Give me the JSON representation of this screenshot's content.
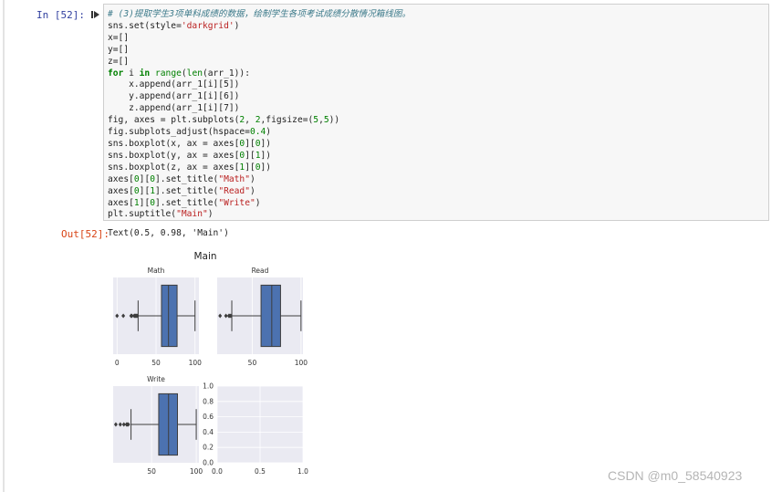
{
  "cell": {
    "in_prompt": "In  [52]:",
    "out_prompt": "Out[52]:",
    "output_text": "Text(0.5, 0.98, 'Main')",
    "code": {
      "line1": "# (3)提取学生3项单科成绩的数据，绘制学生各项考试成绩分散情况箱线图。",
      "l2a": "sns.set(style=",
      "l2b": "'darkgrid'",
      "l2c": ")",
      "l3": "x=[]",
      "l4": "y=[]",
      "l5": "z=[]",
      "l6a": "for",
      "l6b": " i ",
      "l6c": "in",
      "l6d": " ",
      "l6e": "range",
      "l6f": "(",
      "l6g": "len",
      "l6h": "(arr_1)):",
      "l7": "    x.append(arr_1[i][5])",
      "l8": "    y.append(arr_1[i][6])",
      "l9": "    z.append(arr_1[i][7])",
      "l10a": "fig, axes = plt.subplots(",
      "l10b": "2",
      "l10c": ", ",
      "l10d": "2",
      "l10e": ",figsize=(",
      "l10f": "5",
      "l10g": ",",
      "l10h": "5",
      "l10i": "))",
      "l11a": "fig.subplots_adjust(hspace=",
      "l11b": "0.4",
      "l11c": ")",
      "l12a": "sns.boxplot(x, ax = axes[",
      "l12b": "0",
      "l12c": "][",
      "l12d": "0",
      "l12e": "])",
      "l13a": "sns.boxplot(y, ax = axes[",
      "l13b": "0",
      "l13c": "][",
      "l13d": "1",
      "l13e": "])",
      "l14a": "sns.boxplot(z, ax = axes[",
      "l14b": "1",
      "l14c": "][",
      "l14d": "0",
      "l14e": "])",
      "l15a": "axes[",
      "l15b": "0",
      "l15c": "][",
      "l15d": "0",
      "l15e": "].set_title(",
      "l15f": "\"Math\"",
      "l15g": ")",
      "l16a": "axes[",
      "l16b": "0",
      "l16c": "][",
      "l16d": "1",
      "l16e": "].set_title(",
      "l16f": "\"Read\"",
      "l16g": ")",
      "l17a": "axes[",
      "l17b": "1",
      "l17c": "][",
      "l17d": "0",
      "l17e": "].set_title(",
      "l17f": "\"Write\"",
      "l17g": ")",
      "l18a": "plt.suptitle(",
      "l18b": "\"Main\"",
      "l18c": ")"
    }
  },
  "colors": {
    "box_fill": "#4c72b0",
    "axes_bg": "#eaeaf2",
    "prompt_in": "#303f9f",
    "prompt_out": "#d84315"
  },
  "icons": {
    "run": "run-arrow-icon"
  },
  "chart_data": [
    {
      "type": "boxplot",
      "title": "Main",
      "subplot": "suptitle"
    },
    {
      "type": "boxplot",
      "title": "Math",
      "xlim": [
        -5,
        105
      ],
      "xticks": [
        0,
        50,
        100
      ],
      "min": 27,
      "q1": 57,
      "median": 66,
      "q3": 77,
      "max": 100,
      "outliers": [
        0,
        8,
        18,
        19,
        22,
        23,
        24,
        25,
        26
      ]
    },
    {
      "type": "boxplot",
      "title": "Read",
      "xlim": [
        14,
        102
      ],
      "xticks": [
        50,
        100
      ],
      "min": 29,
      "q1": 59,
      "median": 70,
      "q3": 79,
      "max": 100,
      "outliers": [
        17,
        23,
        26,
        27,
        28
      ]
    },
    {
      "type": "boxplot",
      "title": "Write",
      "xlim": [
        7,
        103
      ],
      "xticks": [
        50,
        100
      ],
      "min": 27,
      "q1": 58,
      "median": 69,
      "q3": 79,
      "max": 100,
      "outliers": [
        10,
        15,
        19,
        22,
        23,
        24
      ]
    },
    {
      "type": "empty",
      "title": "",
      "xticks": [
        0.0,
        0.5,
        1.0
      ],
      "yticks": [
        0.0,
        0.2,
        0.4,
        0.6,
        0.8,
        1.0
      ],
      "xlim": [
        0,
        1
      ],
      "ylim": [
        0,
        1
      ]
    }
  ],
  "watermark": "CSDN @m0_58540923"
}
